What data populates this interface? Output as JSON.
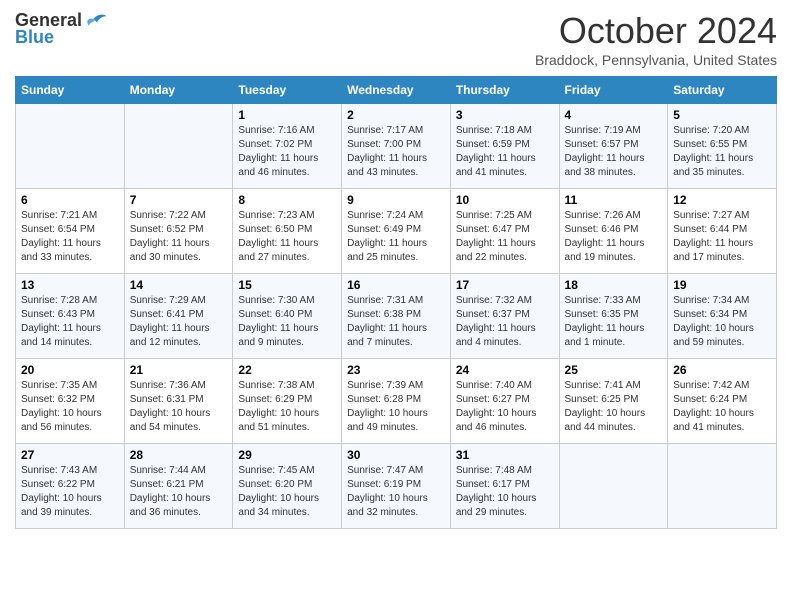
{
  "header": {
    "logo_general": "General",
    "logo_blue": "Blue",
    "month_title": "October 2024",
    "location": "Braddock, Pennsylvania, United States"
  },
  "days_of_week": [
    "Sunday",
    "Monday",
    "Tuesday",
    "Wednesday",
    "Thursday",
    "Friday",
    "Saturday"
  ],
  "weeks": [
    [
      {
        "day": "",
        "sunrise": "",
        "sunset": "",
        "daylight": ""
      },
      {
        "day": "",
        "sunrise": "",
        "sunset": "",
        "daylight": ""
      },
      {
        "day": "1",
        "sunrise": "Sunrise: 7:16 AM",
        "sunset": "Sunset: 7:02 PM",
        "daylight": "Daylight: 11 hours and 46 minutes."
      },
      {
        "day": "2",
        "sunrise": "Sunrise: 7:17 AM",
        "sunset": "Sunset: 7:00 PM",
        "daylight": "Daylight: 11 hours and 43 minutes."
      },
      {
        "day": "3",
        "sunrise": "Sunrise: 7:18 AM",
        "sunset": "Sunset: 6:59 PM",
        "daylight": "Daylight: 11 hours and 41 minutes."
      },
      {
        "day": "4",
        "sunrise": "Sunrise: 7:19 AM",
        "sunset": "Sunset: 6:57 PM",
        "daylight": "Daylight: 11 hours and 38 minutes."
      },
      {
        "day": "5",
        "sunrise": "Sunrise: 7:20 AM",
        "sunset": "Sunset: 6:55 PM",
        "daylight": "Daylight: 11 hours and 35 minutes."
      }
    ],
    [
      {
        "day": "6",
        "sunrise": "Sunrise: 7:21 AM",
        "sunset": "Sunset: 6:54 PM",
        "daylight": "Daylight: 11 hours and 33 minutes."
      },
      {
        "day": "7",
        "sunrise": "Sunrise: 7:22 AM",
        "sunset": "Sunset: 6:52 PM",
        "daylight": "Daylight: 11 hours and 30 minutes."
      },
      {
        "day": "8",
        "sunrise": "Sunrise: 7:23 AM",
        "sunset": "Sunset: 6:50 PM",
        "daylight": "Daylight: 11 hours and 27 minutes."
      },
      {
        "day": "9",
        "sunrise": "Sunrise: 7:24 AM",
        "sunset": "Sunset: 6:49 PM",
        "daylight": "Daylight: 11 hours and 25 minutes."
      },
      {
        "day": "10",
        "sunrise": "Sunrise: 7:25 AM",
        "sunset": "Sunset: 6:47 PM",
        "daylight": "Daylight: 11 hours and 22 minutes."
      },
      {
        "day": "11",
        "sunrise": "Sunrise: 7:26 AM",
        "sunset": "Sunset: 6:46 PM",
        "daylight": "Daylight: 11 hours and 19 minutes."
      },
      {
        "day": "12",
        "sunrise": "Sunrise: 7:27 AM",
        "sunset": "Sunset: 6:44 PM",
        "daylight": "Daylight: 11 hours and 17 minutes."
      }
    ],
    [
      {
        "day": "13",
        "sunrise": "Sunrise: 7:28 AM",
        "sunset": "Sunset: 6:43 PM",
        "daylight": "Daylight: 11 hours and 14 minutes."
      },
      {
        "day": "14",
        "sunrise": "Sunrise: 7:29 AM",
        "sunset": "Sunset: 6:41 PM",
        "daylight": "Daylight: 11 hours and 12 minutes."
      },
      {
        "day": "15",
        "sunrise": "Sunrise: 7:30 AM",
        "sunset": "Sunset: 6:40 PM",
        "daylight": "Daylight: 11 hours and 9 minutes."
      },
      {
        "day": "16",
        "sunrise": "Sunrise: 7:31 AM",
        "sunset": "Sunset: 6:38 PM",
        "daylight": "Daylight: 11 hours and 7 minutes."
      },
      {
        "day": "17",
        "sunrise": "Sunrise: 7:32 AM",
        "sunset": "Sunset: 6:37 PM",
        "daylight": "Daylight: 11 hours and 4 minutes."
      },
      {
        "day": "18",
        "sunrise": "Sunrise: 7:33 AM",
        "sunset": "Sunset: 6:35 PM",
        "daylight": "Daylight: 11 hours and 1 minute."
      },
      {
        "day": "19",
        "sunrise": "Sunrise: 7:34 AM",
        "sunset": "Sunset: 6:34 PM",
        "daylight": "Daylight: 10 hours and 59 minutes."
      }
    ],
    [
      {
        "day": "20",
        "sunrise": "Sunrise: 7:35 AM",
        "sunset": "Sunset: 6:32 PM",
        "daylight": "Daylight: 10 hours and 56 minutes."
      },
      {
        "day": "21",
        "sunrise": "Sunrise: 7:36 AM",
        "sunset": "Sunset: 6:31 PM",
        "daylight": "Daylight: 10 hours and 54 minutes."
      },
      {
        "day": "22",
        "sunrise": "Sunrise: 7:38 AM",
        "sunset": "Sunset: 6:29 PM",
        "daylight": "Daylight: 10 hours and 51 minutes."
      },
      {
        "day": "23",
        "sunrise": "Sunrise: 7:39 AM",
        "sunset": "Sunset: 6:28 PM",
        "daylight": "Daylight: 10 hours and 49 minutes."
      },
      {
        "day": "24",
        "sunrise": "Sunrise: 7:40 AM",
        "sunset": "Sunset: 6:27 PM",
        "daylight": "Daylight: 10 hours and 46 minutes."
      },
      {
        "day": "25",
        "sunrise": "Sunrise: 7:41 AM",
        "sunset": "Sunset: 6:25 PM",
        "daylight": "Daylight: 10 hours and 44 minutes."
      },
      {
        "day": "26",
        "sunrise": "Sunrise: 7:42 AM",
        "sunset": "Sunset: 6:24 PM",
        "daylight": "Daylight: 10 hours and 41 minutes."
      }
    ],
    [
      {
        "day": "27",
        "sunrise": "Sunrise: 7:43 AM",
        "sunset": "Sunset: 6:22 PM",
        "daylight": "Daylight: 10 hours and 39 minutes."
      },
      {
        "day": "28",
        "sunrise": "Sunrise: 7:44 AM",
        "sunset": "Sunset: 6:21 PM",
        "daylight": "Daylight: 10 hours and 36 minutes."
      },
      {
        "day": "29",
        "sunrise": "Sunrise: 7:45 AM",
        "sunset": "Sunset: 6:20 PM",
        "daylight": "Daylight: 10 hours and 34 minutes."
      },
      {
        "day": "30",
        "sunrise": "Sunrise: 7:47 AM",
        "sunset": "Sunset: 6:19 PM",
        "daylight": "Daylight: 10 hours and 32 minutes."
      },
      {
        "day": "31",
        "sunrise": "Sunrise: 7:48 AM",
        "sunset": "Sunset: 6:17 PM",
        "daylight": "Daylight: 10 hours and 29 minutes."
      },
      {
        "day": "",
        "sunrise": "",
        "sunset": "",
        "daylight": ""
      },
      {
        "day": "",
        "sunrise": "",
        "sunset": "",
        "daylight": ""
      }
    ]
  ]
}
